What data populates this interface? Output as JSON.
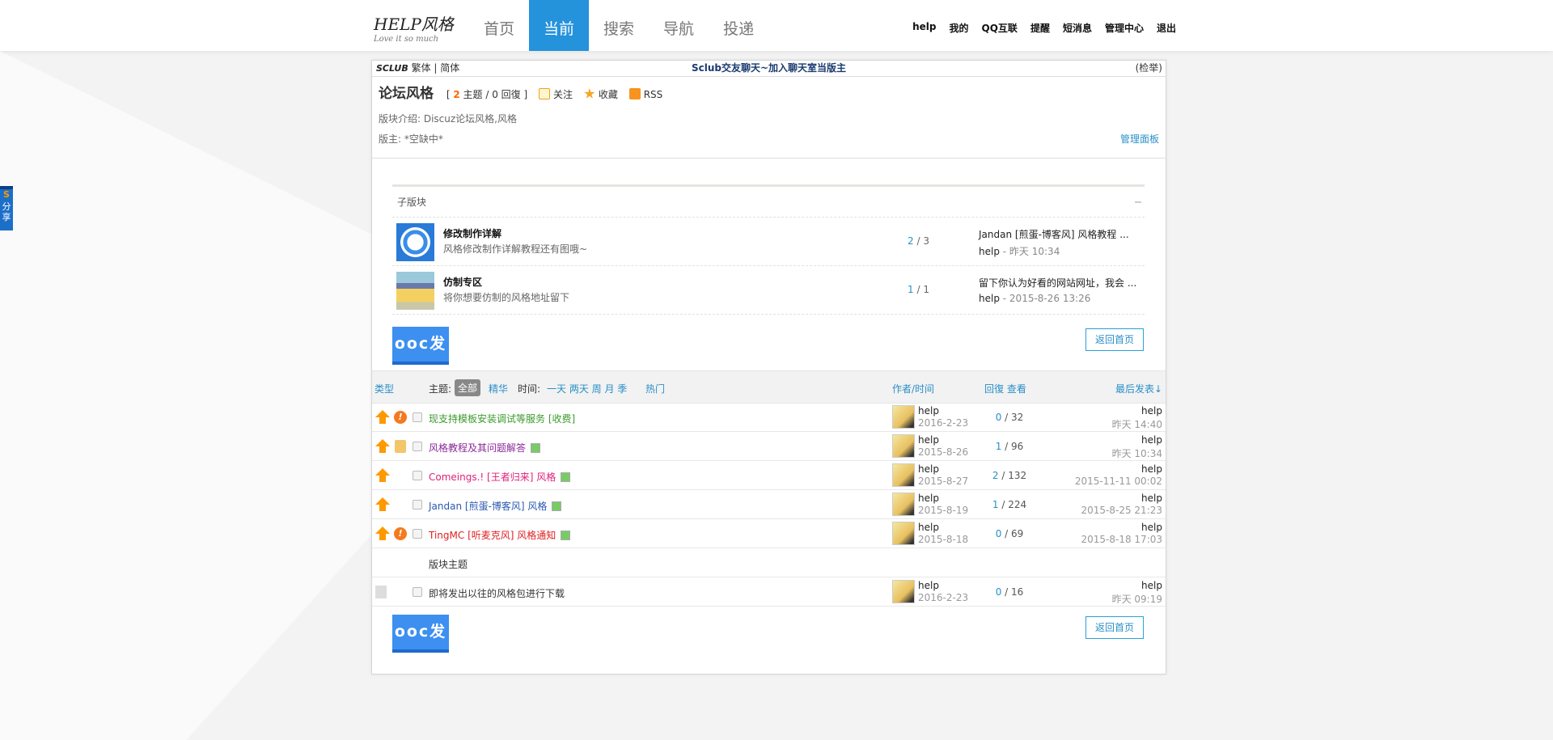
{
  "header": {
    "logo": "HELP风格",
    "logo_tagline": "Love it so much",
    "nav": [
      "首页",
      "当前",
      "搜索",
      "导航",
      "投递"
    ],
    "active_nav": 1,
    "user_links": [
      "help",
      "我的",
      "QQ互联",
      "提醒",
      "短消息",
      "管理中心",
      "退出"
    ]
  },
  "topbar": {
    "brand": "SCLUB",
    "lang": "繁体 | 简体",
    "center": "Sclub交友聊天~加入聊天室当版主",
    "right": "(检举)"
  },
  "forum": {
    "title": "论坛风格",
    "threads": "2",
    "thread_label": "主题",
    "replies_text": "/ 0 回復",
    "follow": "关注",
    "favorite": "收藏",
    "rss": "RSS",
    "intro": "版块介绍: Discuz论坛风格,风格",
    "moderator": "版主: *空缺中*",
    "admin_panel": "管理面板"
  },
  "subforums": {
    "title": "子版块",
    "items": [
      {
        "name": "修改制作详解",
        "desc": "风格修改制作详解教程还有图哦~",
        "threads": "2",
        "posts": "/ 3",
        "last_title": "Jandan [煎蛋-博客风] 风格教程 ...",
        "last_user": "help",
        "last_time": "- 昨天 10:34"
      },
      {
        "name": "仿制专区",
        "desc": "将你想要仿制的风格地址留下",
        "threads": "1",
        "posts": "/ 1",
        "last_title": "留下你认为好看的网站网址，我会 ...",
        "last_user": "help",
        "last_time": "- 2015-8-26 13:26"
      }
    ]
  },
  "buttons": {
    "post": "ooc发帖",
    "back": "返回首页"
  },
  "list_header": {
    "type": "类型",
    "subject": "主题:",
    "all": "全部",
    "digest": "精华",
    "time": "时间:",
    "periods": "一天 两天 周 月 季",
    "hot": "热门",
    "author": "作者/时间",
    "reply_view": "回復 查看",
    "last": "最后发表↓"
  },
  "threads": [
    {
      "title": "现支持模板安装调试等服务 [收费]",
      "color": "#3a9a2a",
      "warn": true,
      "author": "help",
      "date": "2016-2-23",
      "replies": "0",
      "views": "/ 32",
      "last_user": "help",
      "last_time": "昨天 14:40"
    },
    {
      "title": "风格教程及其问题解答",
      "color": "#8a2a9a",
      "scroll": true,
      "pic": true,
      "author": "help",
      "date": "2015-8-26",
      "replies": "1",
      "views": "/ 96",
      "last_user": "help",
      "last_time": "昨天 10:34"
    },
    {
      "title": "Comeings.! [王者归来] 风格",
      "color": "#e0207a",
      "pic": true,
      "author": "help",
      "date": "2015-8-27",
      "replies": "2",
      "views": "/ 132",
      "last_user": "help",
      "last_time": "2015-11-11 00:02"
    },
    {
      "title": "Jandan [煎蛋-博客风] 风格",
      "color": "#2a5ab0",
      "pic": true,
      "author": "help",
      "date": "2015-8-19",
      "replies": "1",
      "views": "/ 224",
      "last_user": "help",
      "last_time": "2015-8-25 21:23"
    },
    {
      "title": "TingMC [听麦克风] 风格通知",
      "color": "#e02020",
      "warn": true,
      "pic": true,
      "author": "help",
      "date": "2015-8-18",
      "replies": "0",
      "views": "/ 69",
      "last_user": "help",
      "last_time": "2015-8-18 17:03"
    }
  ],
  "section_label": "版块主题",
  "normal_thread": {
    "title": "即将发出以往的风格包进行下载",
    "author": "help",
    "date": "2016-2-23",
    "replies": "0",
    "views": "/ 16",
    "last_user": "help",
    "last_time": "昨天 09:19"
  },
  "share": {
    "label": "分享"
  }
}
